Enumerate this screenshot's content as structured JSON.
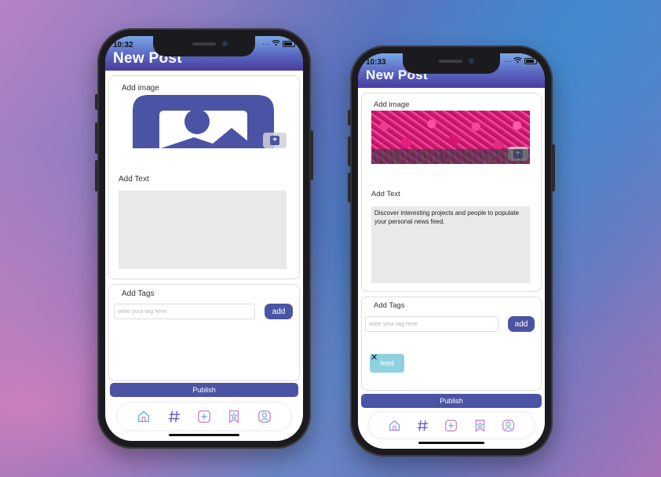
{
  "colors": {
    "primary": "#4b54a4",
    "tag_chip": "#8fd1e0",
    "textarea_bg": "#e9e9ea",
    "header_gradient": [
      "#7aa8e8",
      "#5a67c2",
      "#4a3d9e"
    ]
  },
  "left_phone": {
    "status_time": "10:32",
    "title": "New Post",
    "image_label": "Add image",
    "image_state": "placeholder",
    "text_label": "Add Text",
    "text_value": "",
    "tags_label": "Add Tags",
    "tag_placeholder": "write your tag here",
    "add_label": "add",
    "publish_label": "Publish",
    "tabs": [
      "home-icon",
      "hashtag-icon",
      "add-post-icon",
      "bookmark-icon",
      "profile-icon"
    ]
  },
  "right_phone": {
    "status_time": "10:33",
    "title": "New Post",
    "image_label": "Add image",
    "image_state": "flower-photo",
    "text_label": "Add Text",
    "text_value": "Discover interesting projects and people to populate your personal news feed.",
    "tags_label": "Add Tags",
    "tag_placeholder": "write your tag here",
    "add_label": "add",
    "tags": [
      {
        "label": "feed",
        "close": "✕"
      }
    ],
    "publish_label": "Publish",
    "tabs": [
      "home-icon",
      "hashtag-icon",
      "add-post-icon",
      "bookmark-icon",
      "profile-icon"
    ]
  }
}
